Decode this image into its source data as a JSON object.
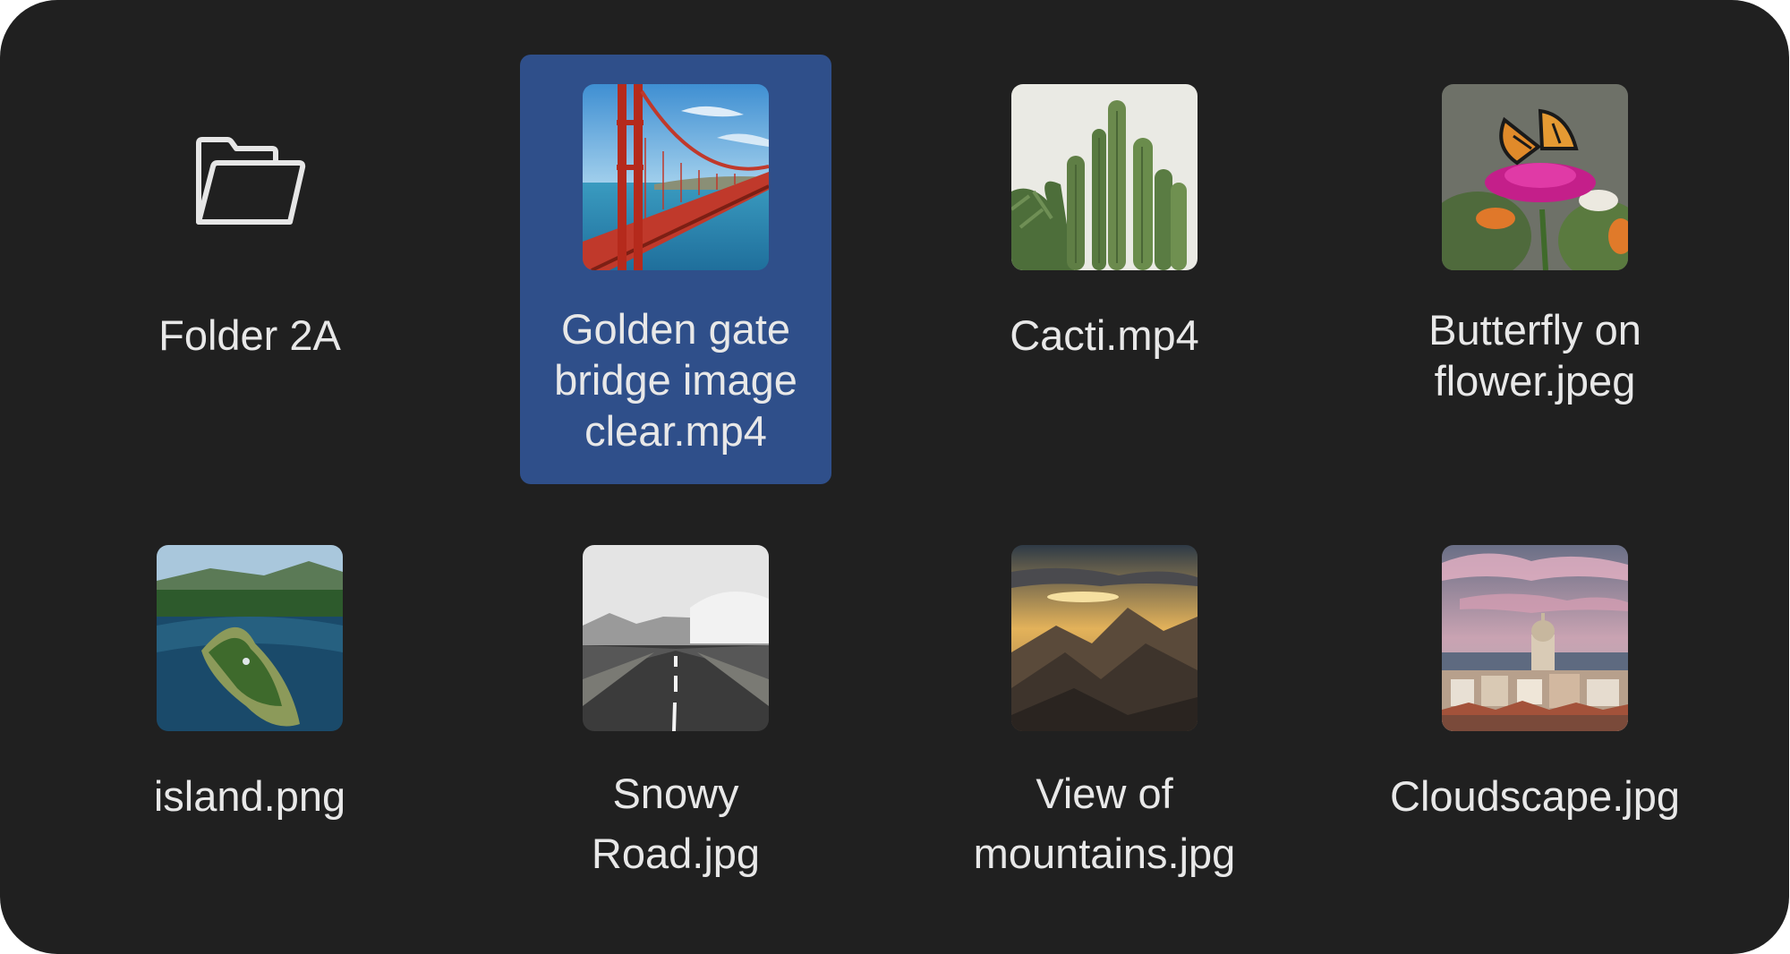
{
  "files": [
    {
      "name": "Folder 2A",
      "kind": "folder-icon"
    },
    {
      "name": "Golden gate bridge image clear.mp4",
      "kind": "bridge-thumbnail",
      "selected": true
    },
    {
      "name": "Cacti.mp4",
      "kind": "cacti-thumbnail"
    },
    {
      "name": "Butterfly on flower.jpeg",
      "kind": "butterfly-thumbnail"
    },
    {
      "name": "island.png",
      "kind": "island-thumbnail"
    },
    {
      "name": "Snowy Road.jpg",
      "kind": "road-thumbnail"
    },
    {
      "name": "View of mountains.jpg",
      "kind": "mountains-thumbnail"
    },
    {
      "name": "Cloudscape.jpg",
      "kind": "cityscape-thumbnail"
    }
  ],
  "colors": {
    "background": "#202020",
    "selection": "#2f4f8a",
    "text": "#e8e8e8"
  }
}
